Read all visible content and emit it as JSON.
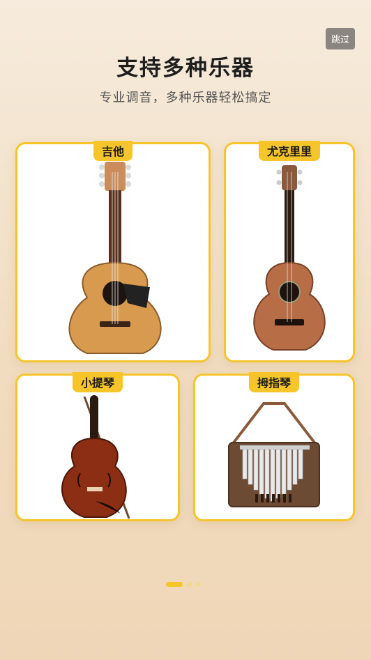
{
  "header": {
    "skip_label": "跳过",
    "title": "支持多种乐器",
    "subtitle": "专业调音，多种乐器轻松搞定"
  },
  "instruments": [
    {
      "label": "吉他",
      "icon": "guitar-icon"
    },
    {
      "label": "尤克里里",
      "icon": "ukulele-icon"
    },
    {
      "label": "小提琴",
      "icon": "violin-icon"
    },
    {
      "label": "拇指琴",
      "icon": "kalimba-icon"
    }
  ],
  "pager": {
    "count": 3,
    "active": 0
  },
  "colors": {
    "accent": "#f6c52a",
    "wood_light": "#d79a4e",
    "wood_dark": "#8b4a2a"
  }
}
